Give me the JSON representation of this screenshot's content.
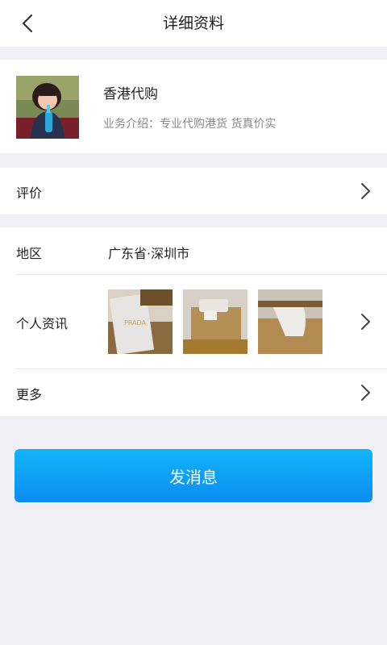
{
  "nav": {
    "title": "详细资料"
  },
  "profile": {
    "name": "香港代购",
    "description": "业务介绍：专业代购港货 货真价实"
  },
  "rating": {
    "label": "评价"
  },
  "region": {
    "label": "地区",
    "value": "广东省·深圳市"
  },
  "news": {
    "label": "个人资讯"
  },
  "more": {
    "label": "更多"
  },
  "send_button": {
    "label": "发消息"
  },
  "colors": {
    "accent": "#0b8df2",
    "background": "#efeff4"
  }
}
